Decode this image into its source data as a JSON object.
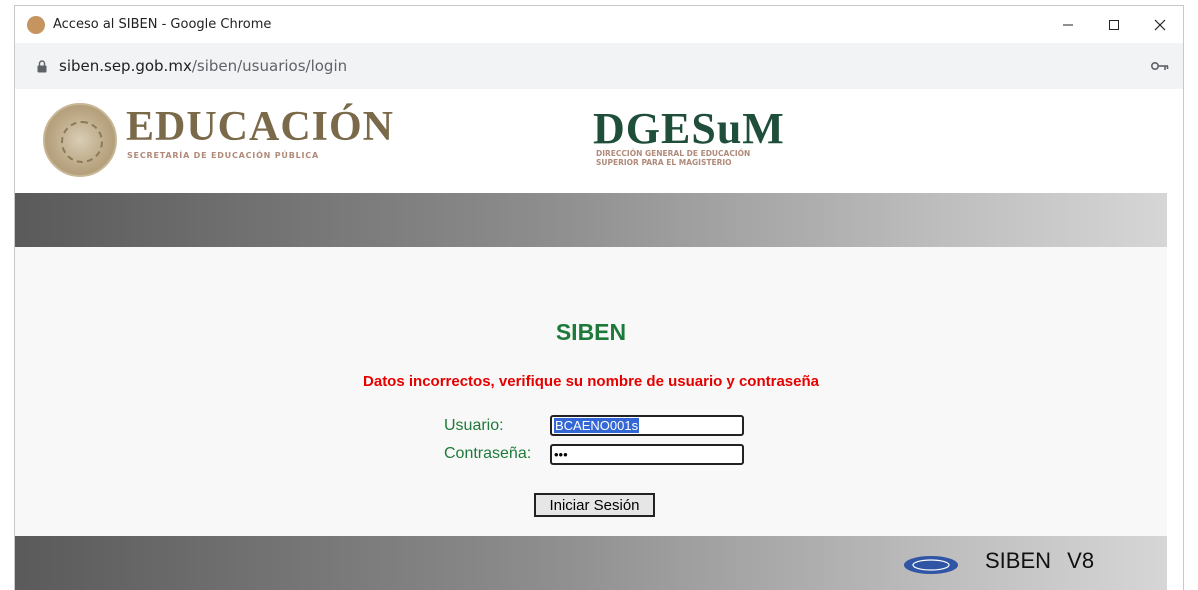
{
  "window": {
    "title": "Acceso al SIBEN - Google Chrome",
    "controls": {
      "minimize": "minimize-icon",
      "maximize": "maximize-icon",
      "close": "close-icon"
    }
  },
  "address": {
    "host": "siben.sep.gob.mx",
    "path": "/siben/usuarios/login"
  },
  "header": {
    "edu_title": "EDUCACIÓN",
    "edu_subtitle": "SECRETARÍA DE EDUCACIÓN PÚBLICA",
    "dges_title": "DGESuM",
    "dges_subtitle_line1": "DIRECCIÓN GENERAL DE EDUCACIÓN",
    "dges_subtitle_line2": "SUPERIOR PARA EL MAGISTERIO"
  },
  "login": {
    "app_title": "SIBEN",
    "error_message": "Datos incorrectos, verifique su nombre de usuario y contraseña",
    "user_label": "Usuario:",
    "user_value": "BCAENO001s",
    "pass_label": "Contraseña:",
    "pass_value": "•••",
    "submit_label": "Iniciar Sesión"
  },
  "footer": {
    "product": "SIBEN",
    "version": "V8"
  },
  "colors": {
    "accent_green": "#1e7a3a",
    "error_red": "#e60000",
    "selection_blue": "#3367d6"
  }
}
